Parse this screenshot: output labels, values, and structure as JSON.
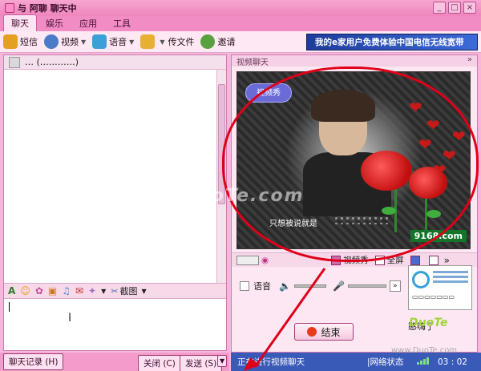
{
  "window": {
    "title": "与 阿聊 聊天中",
    "min": "_",
    "max": "□",
    "close": "×"
  },
  "tabs": [
    "聊天",
    "娱乐",
    "应用",
    "工具"
  ],
  "toolbar": {
    "items": [
      {
        "label": "短信",
        "icon": "sms-icon",
        "color": "#e4a020"
      },
      {
        "label": "视频",
        "icon": "camera-icon",
        "color": "#4a7ac8"
      },
      {
        "label": "语音",
        "icon": "microphone-icon",
        "color": "#3ca0d8"
      },
      {
        "label": "传文件",
        "icon": "file-transfer-icon",
        "color": "#e8b030"
      },
      {
        "label": "邀请",
        "icon": "invite-icon",
        "color": "#58a040"
      }
    ],
    "ad_text": "我的e家用户免费体验中国电信无线宽带"
  },
  "contact": {
    "name": "…  (…………)"
  },
  "format_bar": {
    "screenshot_label": "截图"
  },
  "bottom": {
    "history": "聊天记录 (H)",
    "close": "关闭 (C)",
    "send": "发送 (S)",
    "send_arrow": "▼"
  },
  "video_panel": {
    "header": "视频聊天",
    "badge": "视频秀",
    "subtitle": "只想被说就是",
    "site": "9168.com",
    "controls": {
      "show": "视频秀",
      "fullscreen": "全屏"
    },
    "voice_label": "语音",
    "end_label": "结束",
    "hanle": "憨嗨了"
  },
  "status": {
    "text": "正在进行视频聊天",
    "network": "|网络状态",
    "time": "03 : 02"
  },
  "watermark": "www.DuoTe.com",
  "logo": "DuoTe",
  "logo_sub": "www.DuoTe.com"
}
